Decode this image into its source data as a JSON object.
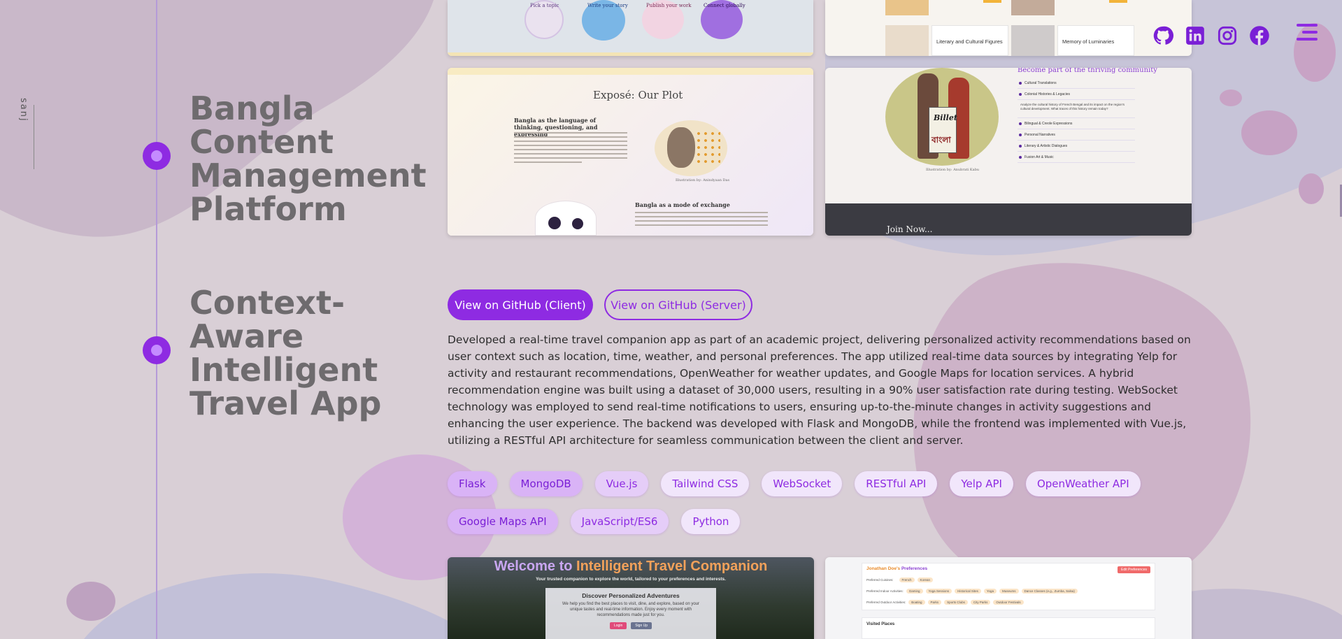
{
  "brand": {
    "vertical_logo": "sanj"
  },
  "header": {
    "social_icons": [
      "github-icon",
      "linkedin-icon",
      "instagram-icon",
      "facebook-icon"
    ],
    "menu_icon": "hamburger-icon"
  },
  "colors": {
    "accent": "#8e2be2",
    "accent_light": "#c48bff",
    "background": "#d9cfd6"
  },
  "projects": [
    {
      "title": "Bangla Content Management Platform",
      "screenshots": {
        "top_left_labels": [
          "Pick a topic",
          "Write your story",
          "Publish your work",
          "Connect globally"
        ],
        "top_right_labels": [
          "Literary and Cultural Figures",
          "Memory of Luminaries"
        ],
        "plot_heading": "Exposé: Our Plot",
        "plot_section1": "Bangla as the language of thinking, questioning, and expressing",
        "plot_section2": "Bangla as a mode of exchange",
        "plot_illustration": "Illustration by: Anindyaan Das",
        "community_heading": "Become part of the thriving community",
        "community_items": [
          "Cultural Translations",
          "Colonial Histories & Legacies",
          "Analyze the cultural history of French Bengal and its impact on the region's cultural development. What traces of this history remain today?",
          "Bilingual & Creole Expressions",
          "Personal Narratives",
          "Literary & Artistic Dialogues",
          "Fusion Art & Music"
        ],
        "community_illustration": "Illustration by: Anubrati Kabu",
        "billet_text_1": "Billet",
        "billet_text_2": "বাংলা",
        "join_text": "Join Now..."
      }
    },
    {
      "title": "Context-Aware Intelligent Travel App",
      "buttons": {
        "client": "View on GitHub (Client)",
        "server": "View on GitHub (Server)"
      },
      "description": "Developed a real-time travel companion app as part of an academic project, delivering personalized activity recommendations based on user context such as location, time, weather, and personal preferences. The app utilized real-time data sources by integrating Yelp for activity and restaurant recommendations, OpenWeather for weather updates, and Google Maps for location services. A hybrid recommendation engine was built using a dataset of 30,000 users, resulting in a 90% user satisfaction rate during testing. WebSocket technology was employed to send real-time notifications to users, ensuring up-to-the-minute changes in activity suggestions and enhancing the user experience. The backend was developed with Flask and MongoDB, while the frontend was implemented with Vue.js, utilizing a RESTful API architecture for seamless communication between the client and server.",
      "tags": [
        "Flask",
        "MongoDB",
        "Vue.js",
        "Tailwind CSS",
        "WebSocket",
        "RESTful API",
        "Yelp API",
        "OpenWeather API",
        "Google Maps API",
        "JavaScript/ES6",
        "Python"
      ],
      "screenshots": {
        "welcome_prefix": "Welcome to",
        "welcome_name": "Intelligent Travel Companion",
        "welcome_sub": "Your trusted companion to explore the world, tailored to your preferences and interests.",
        "discover_title": "Discover Personalized Adventures",
        "discover_text": "We help you find the best places to visit, dine, and explore, based on your unique tastes and real-time information. Enjoy every moment with recommendations made just for you.",
        "login_label": "Login",
        "signup_label": "Sign Up",
        "prefs_owner": "Jonathan Doe's",
        "prefs_title": "Preferences",
        "edit_prefs": "Edit Preferences",
        "pref_rows": [
          {
            "label": "Preferred Cuisines:",
            "chips": [
              "French",
              "Korean"
            ]
          },
          {
            "label": "Preferred Indoor Activities:",
            "chips": [
              "Gaming",
              "Yoga Sessions",
              "Historical Sites",
              "Yoga",
              "Museums",
              "Dance Classes (e.g., Zumba, Salsa)"
            ]
          },
          {
            "label": "Preferred Outdoor Activities:",
            "chips": [
              "Boating",
              "Parks",
              "Sports Clubs",
              "City Parks",
              "Outdoor Festivals"
            ]
          }
        ],
        "visited_places": "Visited Places"
      }
    }
  ]
}
